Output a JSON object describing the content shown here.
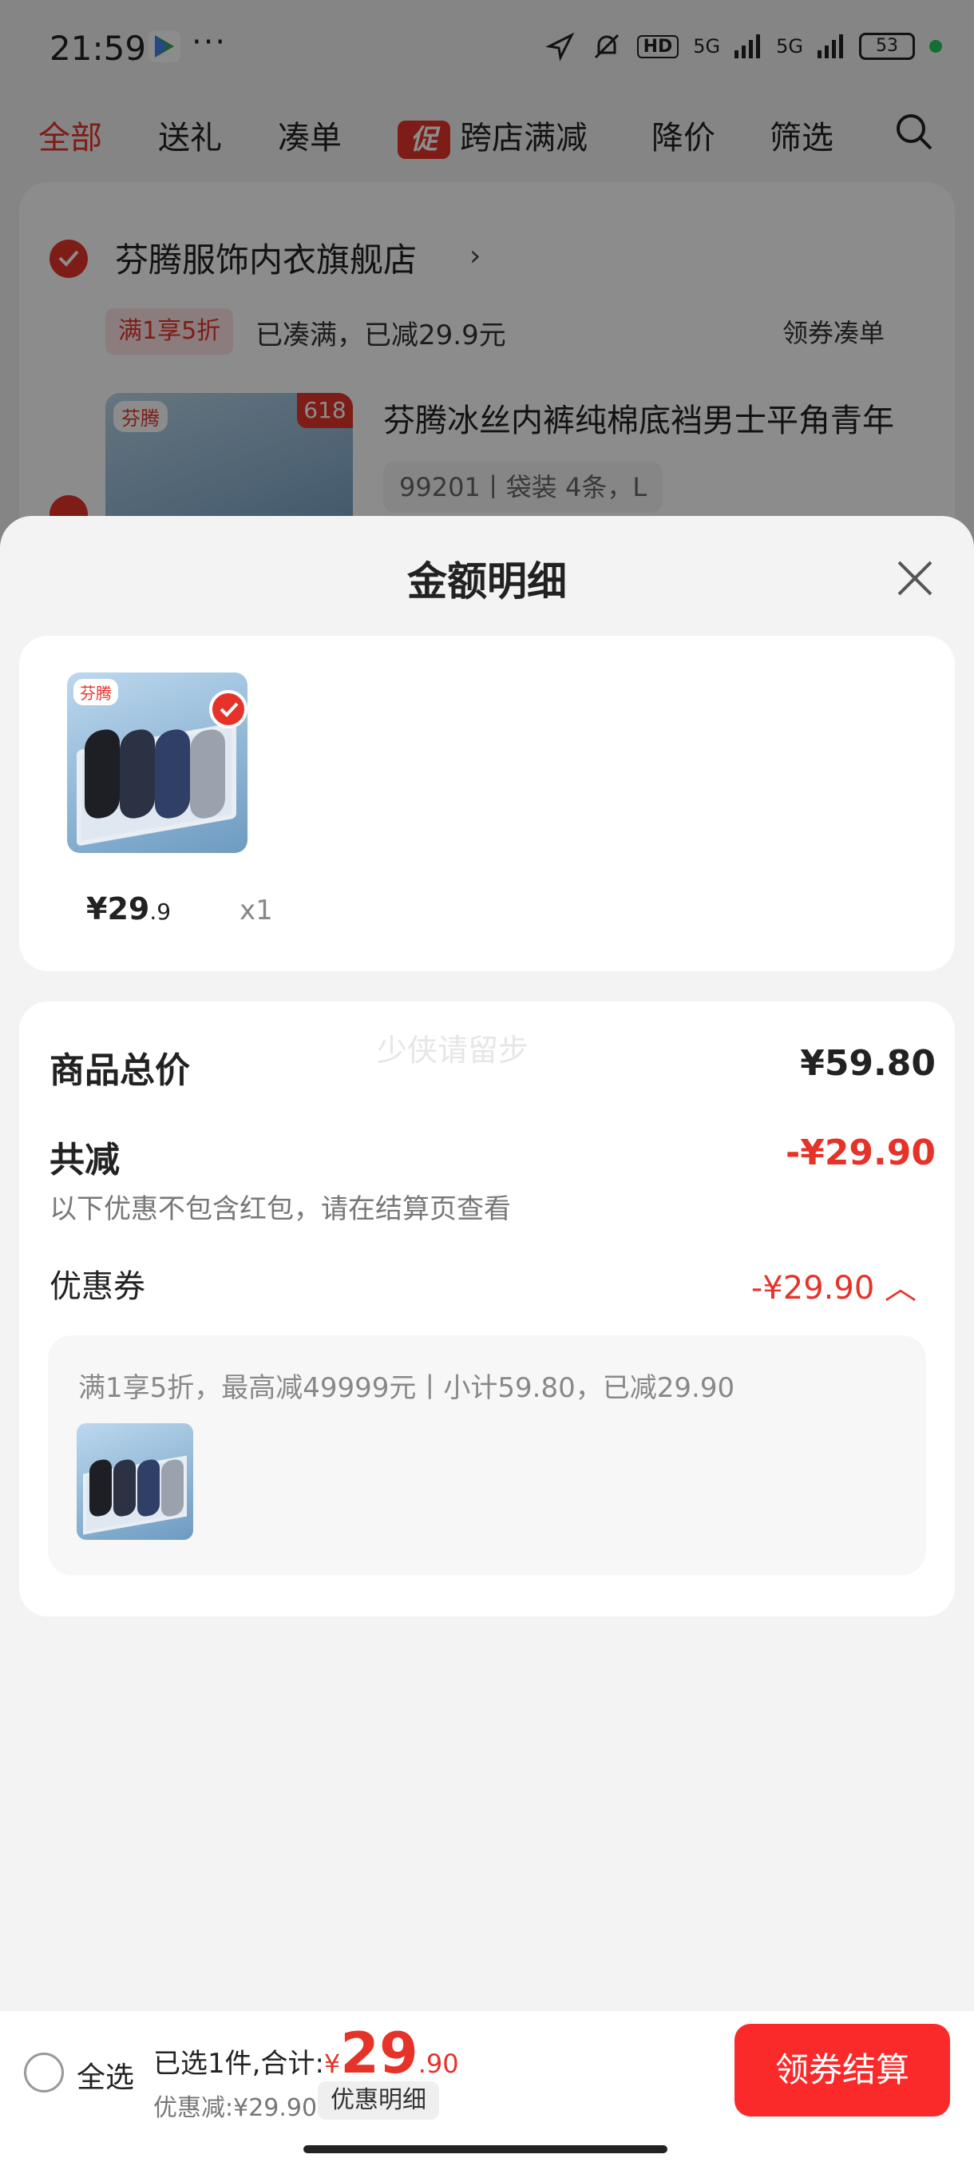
{
  "status_bar": {
    "time": "21:59",
    "more": "···",
    "hd_badge": "HD",
    "network_1": "5G",
    "network_2": "5G",
    "battery": "53"
  },
  "tabs": [
    {
      "label": "全部",
      "active": true
    },
    {
      "label": "送礼",
      "active": false
    },
    {
      "label": "凑单",
      "active": false
    },
    {
      "label": "跨店满减",
      "active": false,
      "badge": "促"
    },
    {
      "label": "降价",
      "active": false
    },
    {
      "label": "筛选",
      "active": false
    }
  ],
  "background_cart": {
    "store_name": "芬腾服饰内衣旗舰店",
    "promo_pill": "满1享5折",
    "promo_text": "已凑满，已减29.9元",
    "coupon_link": "领券凑单",
    "product_logo": "芬腾",
    "sale_tag": "618",
    "product_title": "芬腾冰丝内裤纯棉底裆男士平角青年",
    "product_sku": "99201丨袋装 4条，L"
  },
  "sheet": {
    "title": "金额明细",
    "goods": {
      "logo": "芬腾",
      "price_int": "¥29",
      "price_dec": ".9",
      "qty": "x1"
    },
    "detail": {
      "watermark": "少侠请留步",
      "total_label": "商品总价",
      "total_amount": "¥59.80",
      "reduce_label": "共减",
      "reduce_amount": "-¥29.90",
      "reduce_note": "以下优惠不包含红包，请在结算页查看",
      "coupon_label": "优惠券",
      "coupon_amount": "-¥29.90",
      "coupon_desc": "满1享5折，最高减49999元丨小计59.80，已减29.90"
    }
  },
  "bottom_bar": {
    "select_all": "全选",
    "summary_prefix": "已选1件,合计:",
    "currency": "¥",
    "total_int": "29",
    "total_dec": ".90",
    "discount_line": "优惠减:¥29.90",
    "detail_pill": "优惠明细",
    "checkout": "领券结算"
  },
  "colors": {
    "accent_red": "#e5332a",
    "checkout_red": "#fb2a2a"
  }
}
